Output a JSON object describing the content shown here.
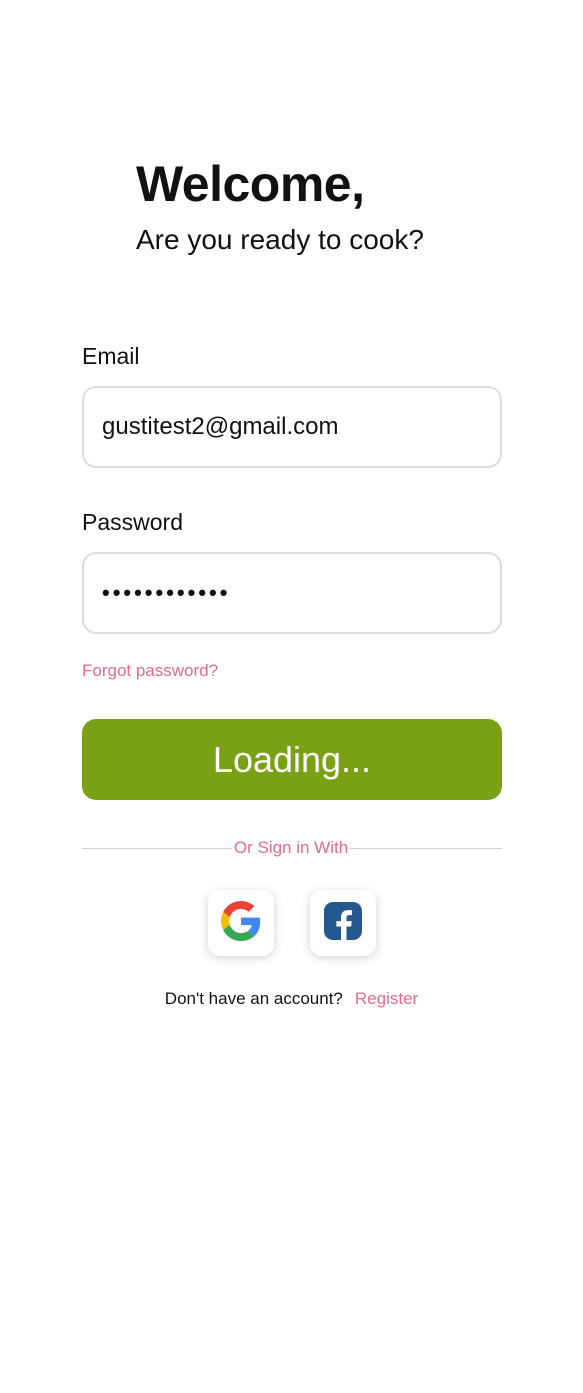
{
  "header": {
    "title": "Welcome,",
    "subtitle": "Are you ready to cook?"
  },
  "form": {
    "email_label": "Email",
    "email_value": "gustitest2@gmail.com",
    "password_label": "Password",
    "password_value": "••••••••••••",
    "forgot_password": "Forgot password?",
    "submit_label": "Loading..."
  },
  "social": {
    "divider_text": "Or Sign in With",
    "google_icon": "google-icon",
    "facebook_icon": "facebook-icon"
  },
  "footer": {
    "prompt": "Don't have an account?",
    "register_label": "Register"
  },
  "colors": {
    "accent_green": "#7aa116",
    "link_pink": "#e8698a",
    "input_border": "#dcdcdc"
  }
}
